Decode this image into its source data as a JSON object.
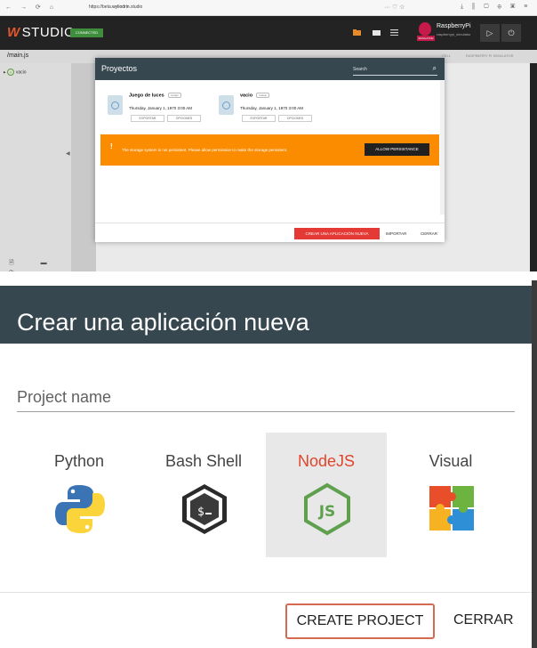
{
  "browser": {
    "nav_icons": "← → ⟳ ⌂",
    "url_prefix": "https://beta.",
    "url_host": "wyliodrin",
    "url_path": ".studio",
    "bookmark_icons": "··· ♡ ☆",
    "right_icons": "⤓ ⫼ ▢ ⊕ ▣ ≡"
  },
  "app": {
    "logo_mark": "W",
    "logo_text": "STUDIO",
    "status_badge": "CONNECTED",
    "device_name": "RaspberryPi",
    "device_sub": "raspberrypi_simulator",
    "device_tag": "SIMULATOR",
    "run_symbol": "▷",
    "power_symbol": "⏻",
    "file_tab": "/main.js",
    "cell_label": "CELL",
    "sim_label": "RASPBERRY PI SIMULATOR",
    "sidebar_project": "vacio",
    "sidebar_tools": "🗎 ▬ ⟳"
  },
  "projects_modal": {
    "title": "Proyectos",
    "search_placeholder": "Search",
    "projects": [
      {
        "name": "Juego de luces",
        "tag": "nodejs",
        "date": "Thursday, January 1, 1970 3:00 AM",
        "export_label": "EXPORTAR",
        "options_label": "OPCIONES"
      },
      {
        "name": "vacio",
        "tag": "nodejs",
        "date": "Thursday, January 1, 1970 3:00 AM",
        "export_label": "EXPORTAR",
        "options_label": "OPCIONES"
      }
    ],
    "warning_icon": "!",
    "warning_text": "The storage system is not persistent. Please allow permission to make the storage persistent.",
    "allow_button": "ALLOW PERSISTANCE",
    "create_new_button": "CREAR UNA APLICACIÓN NUEVA",
    "import_button": "IMPORTAR",
    "close_button": "CERRAR"
  },
  "create_dialog": {
    "title": "Crear una aplicación nueva",
    "project_name_placeholder": "Project name",
    "languages": [
      {
        "name": "Python",
        "icon": "python-icon",
        "selected": false
      },
      {
        "name": "Bash Shell",
        "icon": "bash-icon",
        "selected": false
      },
      {
        "name": "NodeJS",
        "icon": "nodejs-icon",
        "selected": true
      },
      {
        "name": "Visual",
        "icon": "visual-puzzle-icon",
        "selected": false
      }
    ],
    "create_button": "CREATE PROJECT",
    "close_button": "CERRAR"
  },
  "colors": {
    "header_dark": "#37474f",
    "accent_red": "#e53935",
    "warning_orange": "#fb8c00",
    "selected_bg": "#e8e8e8",
    "node_green": "#5fa04e"
  }
}
